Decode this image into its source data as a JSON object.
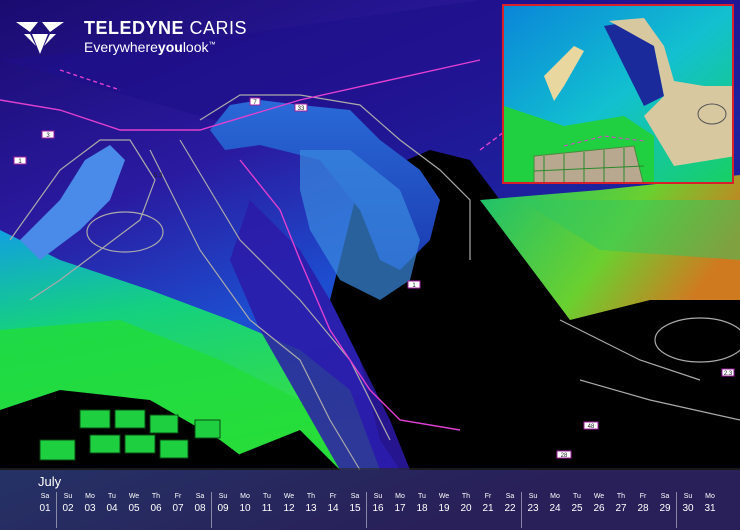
{
  "brand": {
    "name_bold": "TELEDYNE",
    "name_light": "CARIS",
    "tagline_pre": "Everywhere",
    "tagline_bold": "you",
    "tagline_post": "look",
    "trademark": "™"
  },
  "map_labels": [
    "3",
    "1",
    "7",
    "33",
    "1",
    "48",
    "28",
    "2.3",
    "5.3"
  ],
  "calendar": {
    "month": "July",
    "days": [
      {
        "dn": "Sa",
        "dd": "01"
      },
      {
        "dn": "Su",
        "dd": "02"
      },
      {
        "dn": "Mo",
        "dd": "03"
      },
      {
        "dn": "Tu",
        "dd": "04"
      },
      {
        "dn": "We",
        "dd": "05"
      },
      {
        "dn": "Th",
        "dd": "06"
      },
      {
        "dn": "Fr",
        "dd": "07"
      },
      {
        "dn": "Sa",
        "dd": "08"
      },
      {
        "dn": "Su",
        "dd": "09"
      },
      {
        "dn": "Mo",
        "dd": "10"
      },
      {
        "dn": "Tu",
        "dd": "11"
      },
      {
        "dn": "We",
        "dd": "12"
      },
      {
        "dn": "Th",
        "dd": "13"
      },
      {
        "dn": "Fr",
        "dd": "14"
      },
      {
        "dn": "Sa",
        "dd": "15"
      },
      {
        "dn": "Su",
        "dd": "16"
      },
      {
        "dn": "Mo",
        "dd": "17"
      },
      {
        "dn": "Tu",
        "dd": "18"
      },
      {
        "dn": "We",
        "dd": "19"
      },
      {
        "dn": "Th",
        "dd": "20"
      },
      {
        "dn": "Fr",
        "dd": "21"
      },
      {
        "dn": "Sa",
        "dd": "22"
      },
      {
        "dn": "Su",
        "dd": "23"
      },
      {
        "dn": "Mo",
        "dd": "24"
      },
      {
        "dn": "Tu",
        "dd": "25"
      },
      {
        "dn": "We",
        "dd": "26"
      },
      {
        "dn": "Th",
        "dd": "27"
      },
      {
        "dn": "Fr",
        "dd": "28"
      },
      {
        "dn": "Sa",
        "dd": "29"
      },
      {
        "dn": "Su",
        "dd": "30"
      },
      {
        "dn": "Mo",
        "dd": "31"
      }
    ]
  },
  "colors": {
    "deep": "#2a0a8a",
    "mid": "#1a5ad0",
    "shallow": "#1fd060",
    "land": "#000000",
    "inset_border": "#d8202b",
    "chart_line": "#e040d0"
  }
}
